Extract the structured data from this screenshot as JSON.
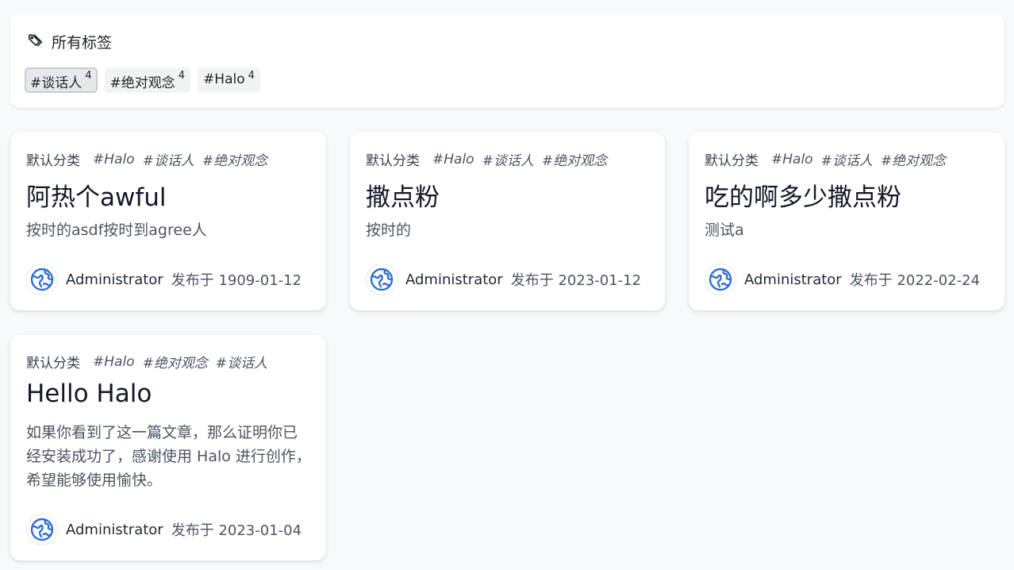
{
  "tags_panel": {
    "title": "所有标签",
    "icon": "tags-icon",
    "tags": [
      {
        "label": "#谈话人",
        "count": "4",
        "active": true
      },
      {
        "label": "#绝对观念",
        "count": "4",
        "active": false
      },
      {
        "label": "#Halo",
        "count": "4",
        "active": false
      }
    ]
  },
  "posts": [
    {
      "category": "默认分类",
      "tags": [
        "#Halo",
        "#谈话人",
        "#绝对观念"
      ],
      "title": "阿热个awful",
      "excerpt": "按时的asdf按时到agree人",
      "author": "Administrator",
      "published": "发布于 1909-01-12"
    },
    {
      "category": "默认分类",
      "tags": [
        "#Halo",
        "#谈话人",
        "#绝对观念"
      ],
      "title": "撒点粉",
      "excerpt": "按时的",
      "author": "Administrator",
      "published": "发布于 2023-01-12"
    },
    {
      "category": "默认分类",
      "tags": [
        "#Halo",
        "#谈话人",
        "#绝对观念"
      ],
      "title": "吃的啊多少撒点粉",
      "excerpt": "测试a",
      "author": "Administrator",
      "published": "发布于 2022-02-24"
    },
    {
      "category": "默认分类",
      "tags": [
        "#Halo",
        "#绝对观念",
        "#谈话人"
      ],
      "title": "Hello Halo",
      "excerpt": "如果你看到了这一篇文章，那么证明你已经安装成功了，感谢使用 Halo 进行创作，希望能够使用愉快。",
      "author": "Administrator",
      "published": "发布于 2023-01-04"
    }
  ],
  "colors": {
    "background": "#f8f9fb",
    "card": "#ffffff",
    "avatar_accent": "#2f6fd3"
  }
}
